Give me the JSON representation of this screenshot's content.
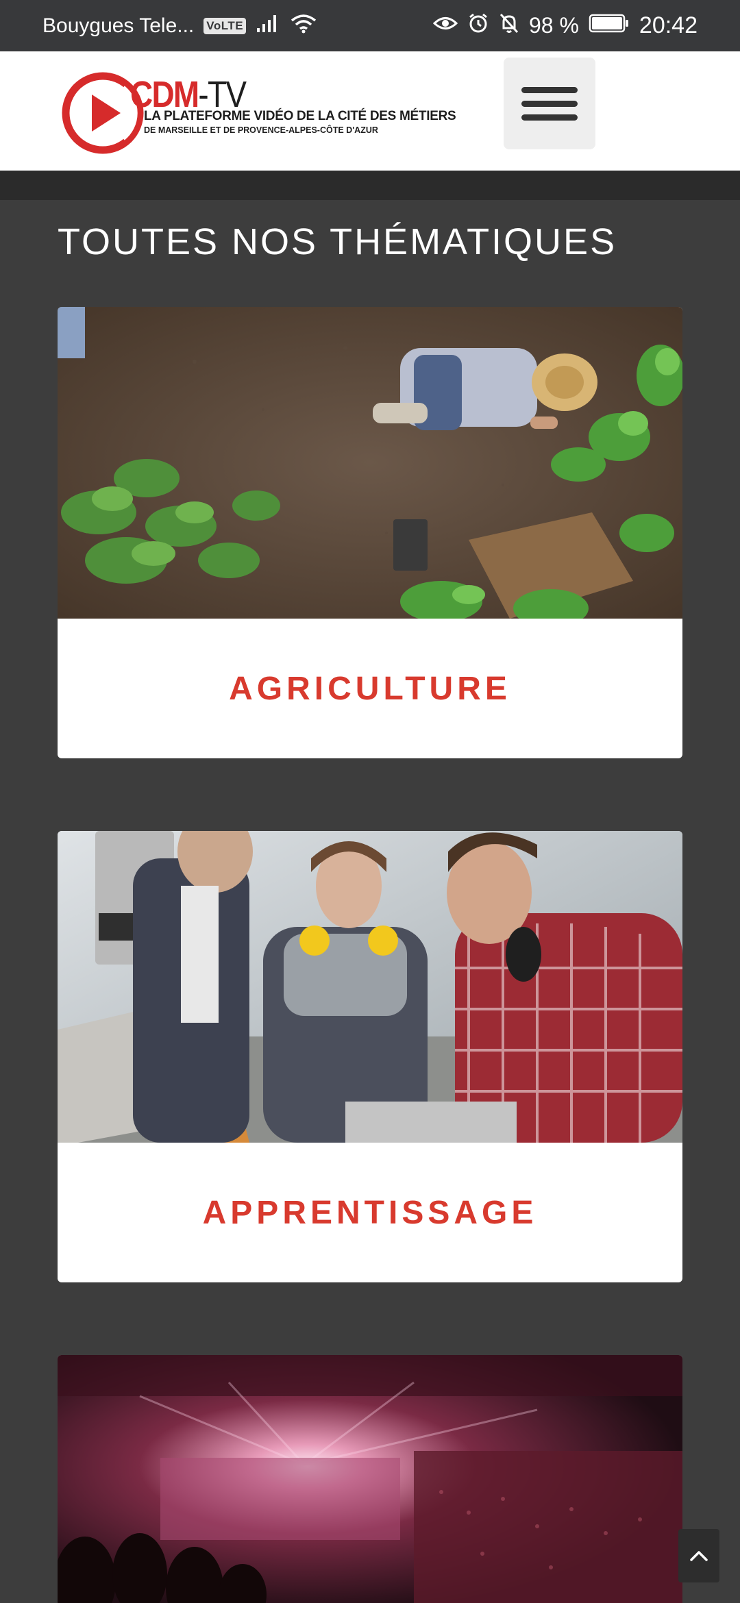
{
  "status_bar": {
    "carrier": "Bouygues Tele...",
    "volte_badge": "VoLTE",
    "battery_percent": "98 %",
    "time": "20:42",
    "icons": [
      "signal-icon",
      "wifi-icon",
      "eye-icon",
      "alarm-icon",
      "bell-off-icon",
      "battery-icon"
    ]
  },
  "header": {
    "logo_brand": "CDM",
    "logo_brand_suffix": "-TV",
    "logo_tagline_1": "LA PLATEFORME VIDÉO DE LA CITÉ DES MÉTIERS",
    "logo_tagline_2": "DE MARSEILLE ET DE PROVENCE-ALPES-CÔTE D'AZUR",
    "menu_icon": "hamburger-menu-icon"
  },
  "main": {
    "title": "TOUTES NOS THÉMATIQUES",
    "cards": [
      {
        "label": "AGRICULTURE",
        "image": "farmers-planting-photo"
      },
      {
        "label": "APPRENTISSAGE",
        "image": "workshop-apprentices-photo"
      },
      {
        "label": "",
        "image": "concert-stage-photo"
      }
    ]
  },
  "colors": {
    "page_background": "#3d3d3d",
    "header_background": "#ffffff",
    "accent_red": "#d83a2e",
    "status_bar": "#38393b"
  },
  "scroll_top_icon": "chevron-up-icon"
}
